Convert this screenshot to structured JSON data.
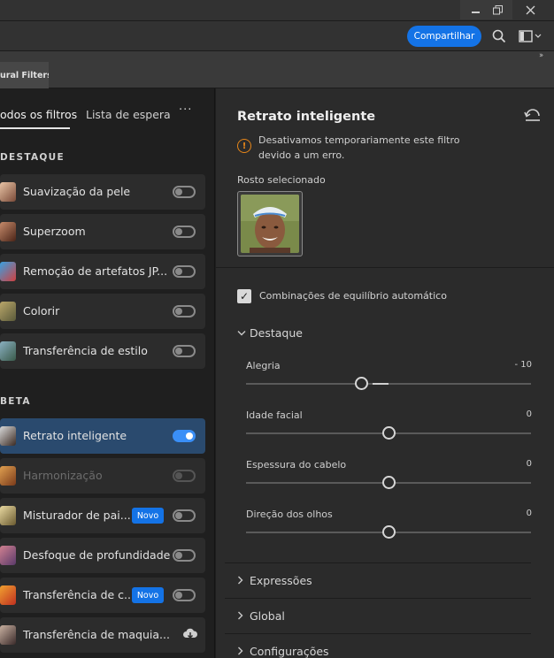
{
  "window": {
    "minimize_icon": "minimize-icon",
    "restore_icon": "restore-icon",
    "close_icon": "close-icon"
  },
  "optionsbar": {
    "share_label": "Compartilhar",
    "search_icon": "search-icon",
    "workspace_icon": "workspace-icon"
  },
  "tabs": {
    "panel_tab": "ural Filters",
    "collapse_icon": "double-chevron-right-icon"
  },
  "left": {
    "tab_all": "odos os filtros",
    "tab_waitlist": "Lista de espera",
    "more": "···",
    "section_featured": "DESTAQUE",
    "section_beta": "BETA",
    "featured_items": [
      {
        "label": "Suavização da pele",
        "toggle": "off"
      },
      {
        "label": "Superzoom",
        "toggle": "off"
      },
      {
        "label": "Remoção de artefatos JP...",
        "toggle": "off"
      },
      {
        "label": "Colorir",
        "toggle": "off"
      },
      {
        "label": "Transferência de estilo",
        "toggle": "off"
      }
    ],
    "beta_items": [
      {
        "label": "Retrato inteligente",
        "toggle": "on"
      },
      {
        "label": "Harmonização",
        "toggle": "off"
      },
      {
        "label": "Misturador de pai...",
        "toggle": "off",
        "badge": "Novo"
      },
      {
        "label": "Desfoque de profundidade",
        "toggle": "off"
      },
      {
        "label": "Transferência de c...",
        "toggle": "off",
        "badge": "Novo"
      },
      {
        "label": "Transferência de maquia...",
        "download": true
      }
    ]
  },
  "right": {
    "title": "Retrato inteligente",
    "warning": "Desativamos temporariamente este filtro devido a um erro.",
    "face_label": "Rosto selecionado",
    "auto_balance_label": "Combinações de equilíbrio automático",
    "auto_balance_checked": true,
    "featured_section": "Destaque",
    "sliders": [
      {
        "label": "Alegria",
        "value": "- 10",
        "numeric": -10
      },
      {
        "label": "Idade facial",
        "value": "0",
        "numeric": 0
      },
      {
        "label": "Espessura do cabelo",
        "value": "0",
        "numeric": 0
      },
      {
        "label": "Direção dos olhos",
        "value": "0",
        "numeric": 0
      }
    ],
    "collapsed_sections": [
      "Expressões",
      "Global",
      "Configurações"
    ]
  },
  "colors": {
    "accent": "#1473e6",
    "toggle_on": "#3a8ff7",
    "warning": "#e68619",
    "selected_item": "#2a4a6e"
  }
}
